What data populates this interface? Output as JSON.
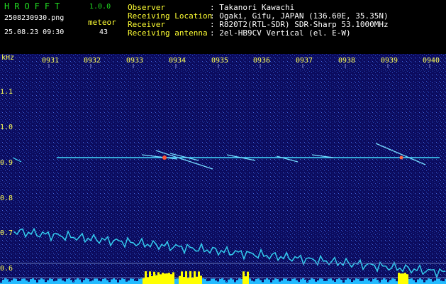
{
  "app": {
    "name": "HROFFT",
    "version": "1.0.0"
  },
  "file": {
    "name": "2508230930.png",
    "datetime": "25.08.23 09:30"
  },
  "meteor": {
    "label": "meteor",
    "count": "43"
  },
  "station": {
    "observer_label": "Observer",
    "observer_value": ": Takanori Kawachi",
    "location_label": "Receiving Location",
    "location_value": ": Ogaki, Gifu, JAPAN (136.60E, 35.35N)",
    "receiver_label": "Receiver",
    "receiver_value": ": R820T2(RTL-SDR) SDR-Sharp 53.1000MHz",
    "antenna_label": "Receiving antenna",
    "antenna_value": ": 2el-HB9CV Vertical (el. E-W)"
  },
  "spectrogram": {
    "y_unit": "kHz",
    "y_ticks": [
      "1.1",
      "1.0",
      "0.9",
      "0.8",
      "0.7",
      "0.6"
    ],
    "x_ticks": [
      "0931",
      "0932",
      "0933",
      "0934",
      "0935",
      "0936",
      "0937",
      "0938",
      "0939",
      "0940"
    ],
    "colors": {
      "background": "#0a0a55",
      "trace": "#33ccee",
      "signal": "#ffff00",
      "carrier": "#44ddff"
    }
  }
}
